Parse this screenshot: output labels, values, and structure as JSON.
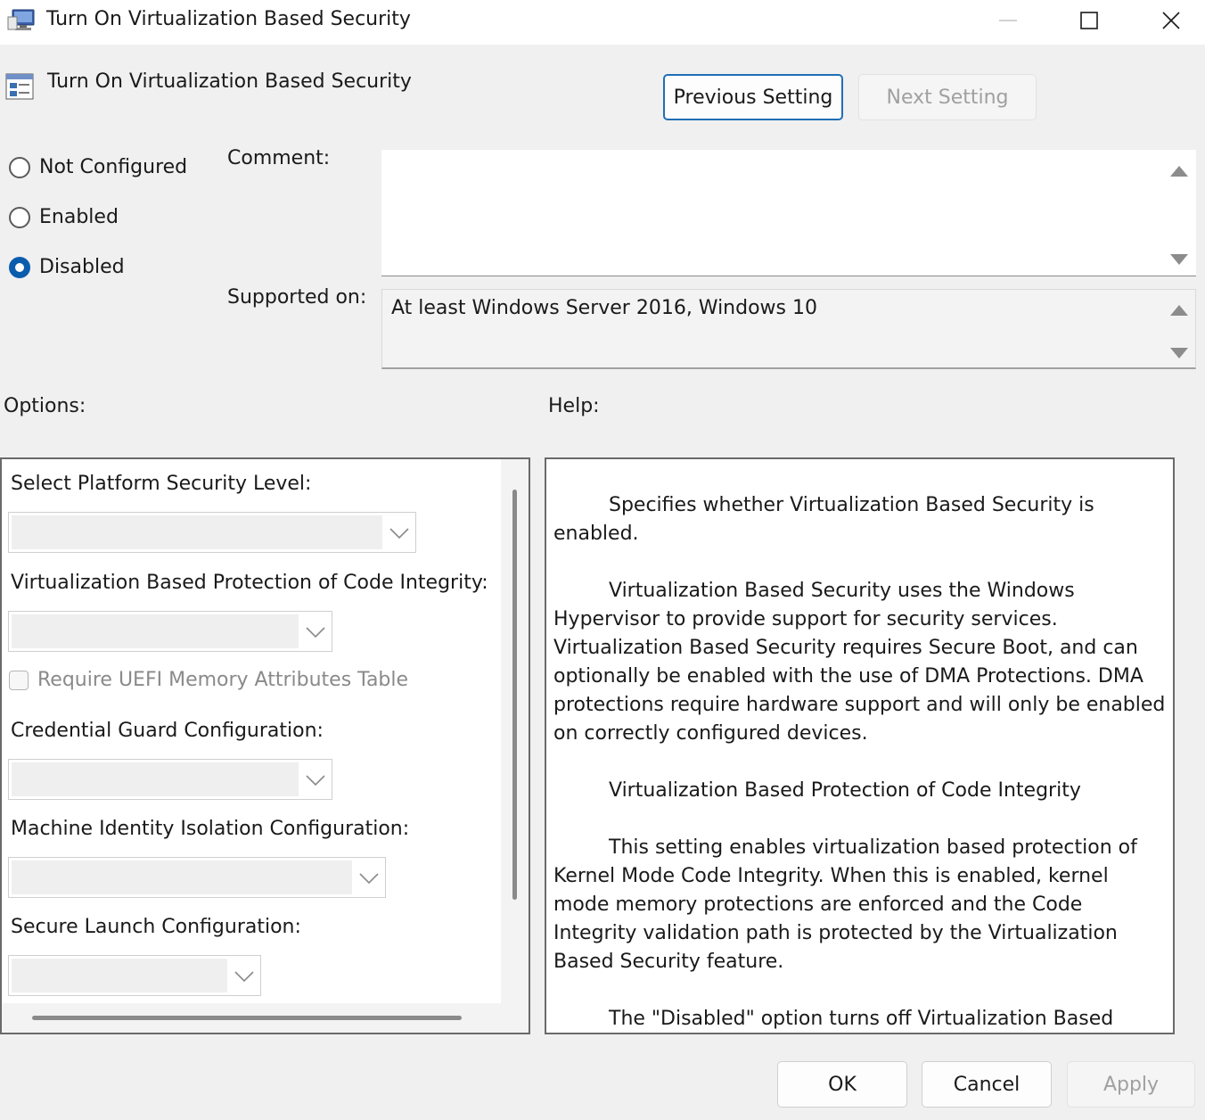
{
  "window": {
    "title": "Turn On Virtualization Based Security",
    "minimize_icon": "minimize-icon",
    "maximize_icon": "maximize-icon",
    "close_icon": "close-icon"
  },
  "header": {
    "policy_title": "Turn On Virtualization Based Security",
    "previous_label": "Previous Setting",
    "next_label": "Next Setting"
  },
  "state": {
    "options": [
      "Not Configured",
      "Enabled",
      "Disabled"
    ],
    "selected": "Disabled"
  },
  "comment": {
    "label": "Comment:",
    "value": ""
  },
  "supported": {
    "label": "Supported on:",
    "value": "At least Windows Server 2016, Windows 10"
  },
  "options": {
    "label": "Options:",
    "platform_level_label": "Select Platform Security Level:",
    "platform_level_value": "",
    "code_integrity_label": "Virtualization Based Protection of Code Integrity:",
    "code_integrity_value": "",
    "uefi_checkbox_label": "Require UEFI Memory Attributes Table",
    "uefi_checked": false,
    "credential_guard_label": "Credential Guard Configuration:",
    "credential_guard_value": "",
    "machine_identity_label": "Machine Identity Isolation Configuration:",
    "machine_identity_value": "",
    "secure_launch_label": "Secure Launch Configuration:",
    "secure_launch_value": ""
  },
  "help": {
    "label": "Help:",
    "paragraphs": [
      "Specifies whether Virtualization Based Security is enabled.",
      "Virtualization Based Security uses the Windows Hypervisor to provide support for security services. Virtualization Based Security requires Secure Boot, and can optionally be enabled with the use of DMA Protections. DMA protections require hardware support and will only be enabled on correctly configured devices.",
      "Virtualization Based Protection of Code Integrity",
      "This setting enables virtualization based protection of Kernel Mode Code Integrity. When this is enabled, kernel mode memory protections are enforced and the Code Integrity validation path is protected by the Virtualization Based Security feature.",
      "The \"Disabled\" option turns off Virtualization Based Protection of Code Integrity remotely if it was previously turned on with the \"Enabled without lock\" option."
    ]
  },
  "footer": {
    "ok_label": "OK",
    "cancel_label": "Cancel",
    "apply_label": "Apply"
  },
  "colors": {
    "accent": "#0b5cad",
    "focus_border": "#1f6fb5",
    "disabled_text": "#a0a0a0"
  }
}
